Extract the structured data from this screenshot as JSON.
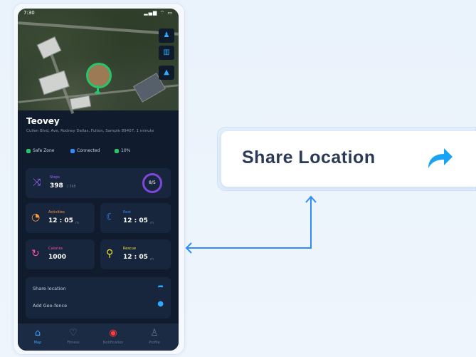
{
  "status_bar": {
    "time": "7:30",
    "icons": "▂▄▆ ⌔ ▭"
  },
  "map": {
    "controls": [
      {
        "icon": "user-icon",
        "glyph": "♟"
      },
      {
        "icon": "map-layers-icon",
        "glyph": "▥"
      },
      {
        "icon": "navigate-icon",
        "glyph": "▲"
      }
    ]
  },
  "pet": {
    "name": "Teovey",
    "address": "Cullen Blvd, Ave, Rodney Dallas, Fulton, Sample 89407, 1 minute"
  },
  "stats": [
    {
      "label": "Safe Zone",
      "color": "#27c46a"
    },
    {
      "label": "Connected",
      "color": "#2f8cff"
    },
    {
      "label": "10%",
      "color": "#27c46a"
    }
  ],
  "cards": {
    "steps": {
      "label": "Steps",
      "value": "398",
      "unit": "/ 3k8",
      "ring": "8/5",
      "color": "#a066ff"
    },
    "grid": [
      {
        "label": "Activities",
        "value": "12 : 05",
        "unit": "m",
        "color": "#ff9a3c",
        "glyph": "◔",
        "icon": "timer-icon"
      },
      {
        "label": "Rest",
        "value": "12 : 05",
        "unit": "m",
        "color": "#2f8cff",
        "glyph": "☾",
        "icon": "rest-icon"
      },
      {
        "label": "Calories",
        "value": "1000",
        "unit": "",
        "color": "#ff4fa3",
        "glyph": "↻",
        "icon": "calories-icon"
      },
      {
        "label": "Rescue",
        "value": "12 : 05",
        "unit": "m",
        "color": "#f3e13a",
        "glyph": "⚲",
        "icon": "rescue-icon"
      }
    ]
  },
  "menu": [
    {
      "label": "Share location",
      "glyph": "➦",
      "icon": "share-icon"
    },
    {
      "label": "Add Geo-fence",
      "glyph": "●",
      "icon": "add-fence-icon"
    }
  ],
  "nav": [
    {
      "label": "Map",
      "glyph": "⌂",
      "icon": "home-icon",
      "active": true
    },
    {
      "label": "Fitness",
      "glyph": "♡",
      "icon": "fitness-icon"
    },
    {
      "label": "Notification",
      "glyph": "◉",
      "icon": "notification-icon"
    },
    {
      "label": "Profile",
      "glyph": "♙",
      "icon": "profile-icon"
    }
  ],
  "callout": {
    "label": "Share Location",
    "accent": "#1aa3f5"
  }
}
